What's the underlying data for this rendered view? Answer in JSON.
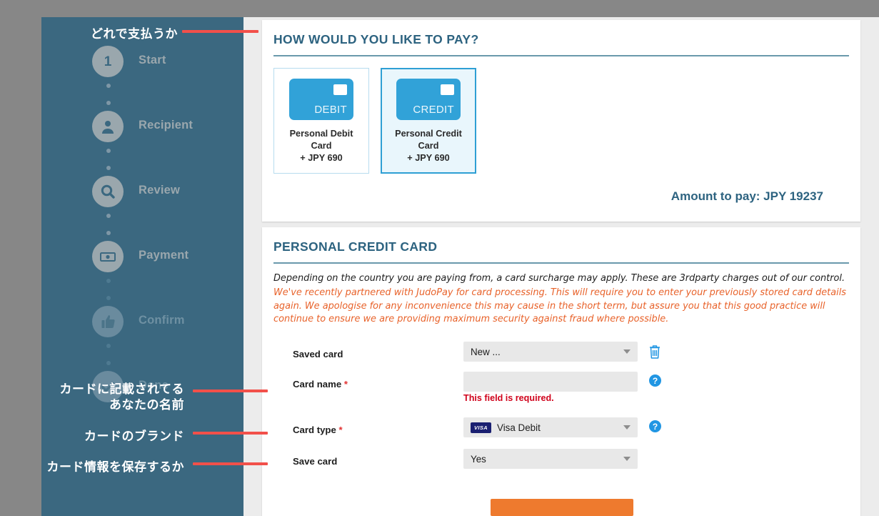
{
  "wizard": {
    "steps": [
      {
        "label": "Start",
        "icon": "number-1-icon",
        "badge": "1",
        "state": "active"
      },
      {
        "label": "Recipient",
        "icon": "person-icon",
        "badge": "",
        "state": "active"
      },
      {
        "label": "Review",
        "icon": "magnifier-icon",
        "badge": "",
        "state": "active"
      },
      {
        "label": "Payment",
        "icon": "banknote-icon",
        "badge": "",
        "state": "active"
      },
      {
        "label": "Confirm",
        "icon": "thumbs-up-icon",
        "badge": "",
        "state": "dim"
      },
      {
        "label": "Done",
        "icon": "check-icon",
        "badge": "",
        "state": "dim"
      }
    ]
  },
  "annotations": [
    {
      "text": "どれで支払うか",
      "target": "payment-method-tiles"
    },
    {
      "line1": "カードに記載されてる",
      "line2": "あなたの名前",
      "target": "card-name-field"
    },
    {
      "text": "カードのブランド",
      "target": "card-type-field"
    },
    {
      "text": "カード情報を保存するか",
      "target": "save-card-field"
    }
  ],
  "pay_panel": {
    "title": "HOW WOULD YOU LIKE TO PAY?",
    "tiles": [
      {
        "art_label": "DEBIT",
        "name": "Personal Debit Card",
        "price": "+ JPY 690",
        "selected": false
      },
      {
        "art_label": "CREDIT",
        "name": "Personal Credit Card",
        "price": "+ JPY 690",
        "selected": true
      }
    ],
    "amount_text": "Amount to pay: JPY 19237"
  },
  "card_panel": {
    "title": "PERSONAL CREDIT CARD",
    "note": "Depending on the country you are paying from, a card surcharge may apply. These are 3rdparty charges out of our control.",
    "warning": "We've recently partnered with JudoPay for card processing. This will require you to enter your previously stored card details again. We apologise for any inconvenience this may cause in the short term, but assure you that this good practice will continue to ensure we are providing maximum security against fraud where possible.",
    "fields": {
      "saved_card": {
        "label": "Saved card",
        "value": "New ...",
        "required": false,
        "trash_icon": "trash-icon"
      },
      "card_name": {
        "label": "Card name",
        "value": "",
        "placeholder": "",
        "required": true,
        "error": "This field is required.",
        "help_icon": "help-icon"
      },
      "card_type": {
        "label": "Card type",
        "value": "Visa Debit",
        "brand": "VISA",
        "required": true,
        "help_icon": "help-icon"
      },
      "save_card": {
        "label": "Save card",
        "value": "Yes",
        "required": false
      }
    },
    "submit_label": ""
  },
  "colors": {
    "sidebar": "#3b6880",
    "panel_title": "#2d6380",
    "accent_blue": "#2e9fd4",
    "warning_orange": "#e8622a",
    "error_red": "#d0021b",
    "submit_orange": "#ee7a2e",
    "annotation_red": "#f2504a"
  }
}
